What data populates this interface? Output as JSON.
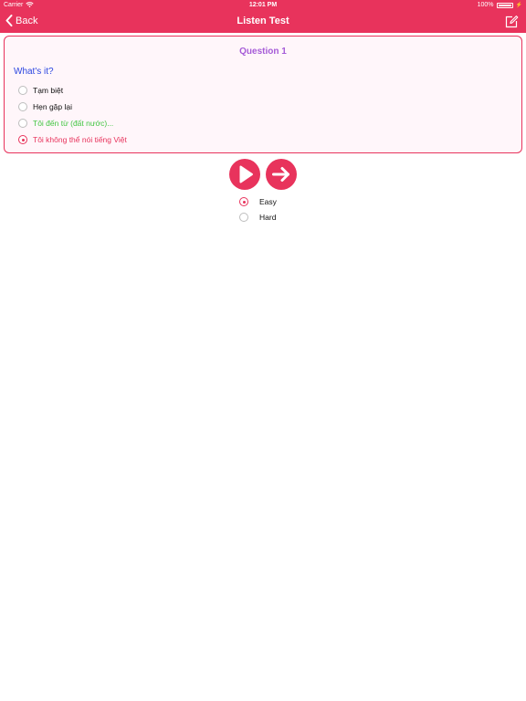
{
  "status_bar": {
    "carrier": "Carrier",
    "time": "12:01 PM",
    "battery": "100%"
  },
  "nav": {
    "back_label": "Back",
    "title": "Listen Test",
    "right_icon": "edit-icon"
  },
  "question": {
    "title": "Question 1",
    "prompt": "What's it?",
    "options": [
      {
        "label": "Tạm biệt",
        "selected": false,
        "state": "normal"
      },
      {
        "label": "Hẹn gặp lại",
        "selected": false,
        "state": "normal"
      },
      {
        "label": "Tôi đến từ (đất nước)...",
        "selected": false,
        "state": "correct"
      },
      {
        "label": "Tôi không thể nói tiếng Việt",
        "selected": true,
        "state": "wrong"
      }
    ]
  },
  "controls": {
    "play_icon": "play-icon",
    "next_icon": "arrow-right-icon"
  },
  "difficulty": {
    "options": [
      {
        "label": "Easy",
        "selected": true
      },
      {
        "label": "Hard",
        "selected": false
      }
    ]
  },
  "colors": {
    "accent": "#e8335c",
    "question_title": "#a55bd7",
    "prompt": "#2b46e0",
    "correct": "#41c541",
    "wrong": "#e8335c",
    "card_background": "#fff6fa"
  }
}
